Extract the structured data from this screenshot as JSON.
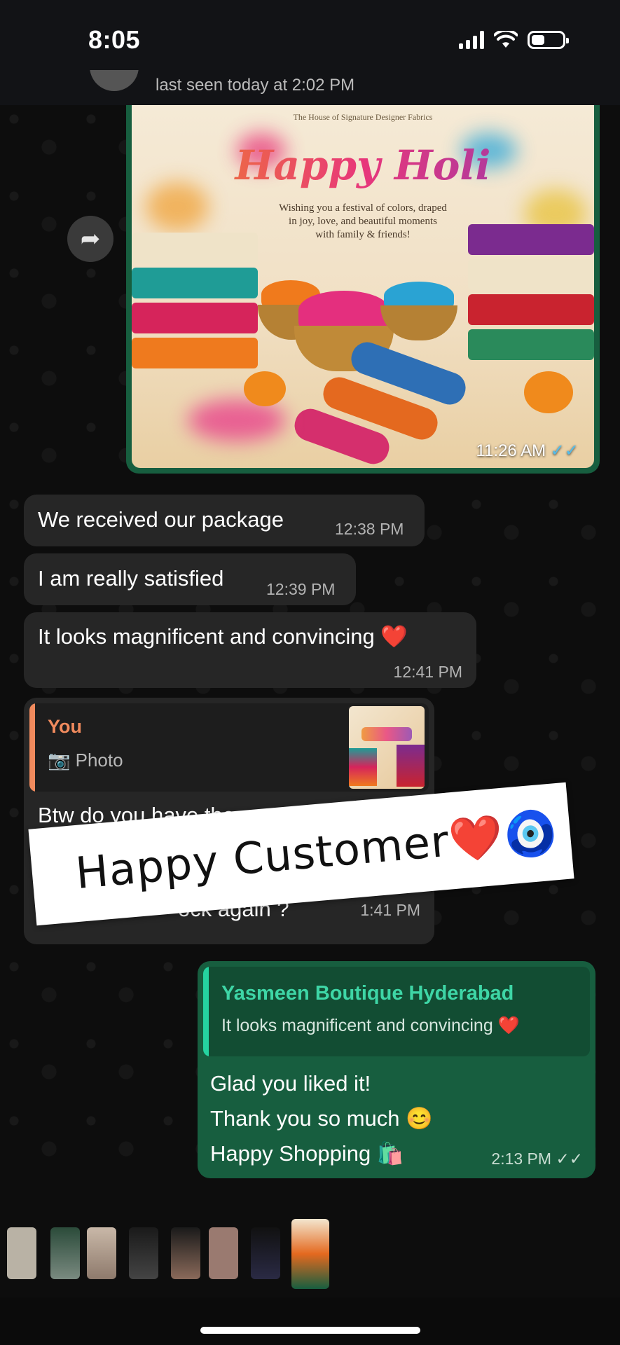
{
  "status_bar": {
    "time": "8:05"
  },
  "header": {
    "last_seen": "last seen today at 2:02 PM"
  },
  "poster": {
    "brand": "The House of Signature Designer Fabrics",
    "title": "Happy Holi",
    "message": "Wishing you a festival of colors, draped in joy, love, and beautiful moments with family & friends!",
    "time": "11:26 AM",
    "ticks": "✓✓"
  },
  "messages": [
    {
      "text": "We received our package",
      "time": "12:38 PM"
    },
    {
      "text": "I am really satisfied",
      "time": "12:39 PM"
    },
    {
      "text": "It looks magnificent and convincing ❤️",
      "time": "12:41 PM"
    }
  ],
  "reply_in": {
    "quote_name": "You",
    "quote_text": "📷 Photo",
    "text_line1": "Btw do you have the same f",
    "text_line2": "ock again ?",
    "time": "1:41 PM"
  },
  "sticker": {
    "text": "Happy Customer❤️🧿"
  },
  "reply_out": {
    "quote_name": "Yasmeen Boutique Hyderabad",
    "quote_text": "It looks magnificent and convincing ❤️",
    "lines": [
      "Glad you liked it!",
      "Thank you so much 😊",
      "Happy Shopping 🛍️"
    ],
    "time": "2:13 PM",
    "ticks": "✓✓"
  },
  "colors": {
    "outgoing_bubble": "#175e3f",
    "incoming_bubble": "#262626",
    "read_tick": "#53bdeb",
    "quote_you": "#f08a5d",
    "quote_contact": "#3ed6a6"
  },
  "icons": [
    "forward-icon",
    "camera-icon",
    "signal-icon",
    "wifi-icon",
    "battery-icon"
  ]
}
